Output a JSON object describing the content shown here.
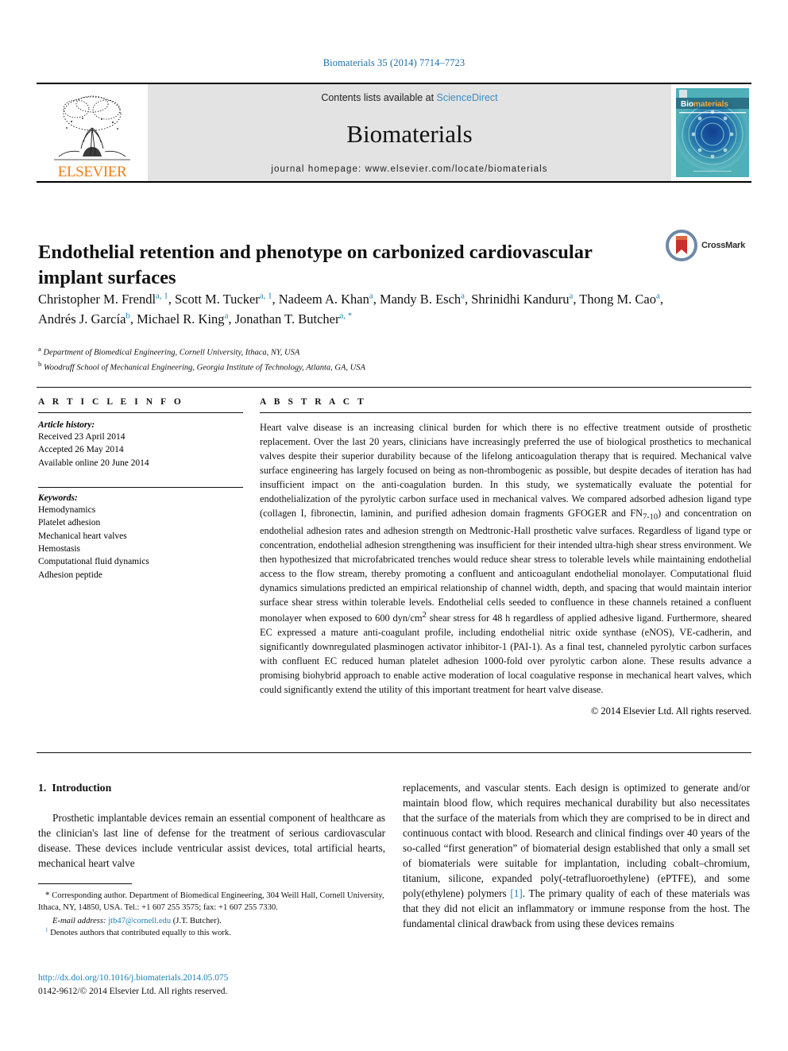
{
  "running_head": "Biomaterials 35 (2014) 7714–7723",
  "masthead": {
    "publisher_name": "ELSEVIER",
    "contents_prefix": "Contents lists available at ",
    "contents_link": "ScienceDirect",
    "journal_name": "Biomaterials",
    "homepage": "journal homepage: www.elsevier.com/locate/biomaterials",
    "cover_title": "Biomaterials",
    "link_color": "#3b8bc4"
  },
  "crossmark": {
    "label": "CrossMark"
  },
  "article": {
    "title": "Endothelial retention and phenotype on carbonized cardiovascular implant surfaces",
    "authors": [
      {
        "name": "Christopher M. Frendl",
        "marks": "a, 1",
        "sep": ", "
      },
      {
        "name": "Scott M. Tucker",
        "marks": "a, 1",
        "sep": ", "
      },
      {
        "name": "Nadeem A. Khan",
        "marks": "a",
        "sep": ", "
      },
      {
        "name": "Mandy B. Esch",
        "marks": "a",
        "sep": ", "
      },
      {
        "name": "Shrinidhi Kanduru",
        "marks": "a",
        "sep": ", "
      },
      {
        "name": "Thong M. Cao",
        "marks": "a",
        "sep": ", "
      },
      {
        "name": "Andrés J. García",
        "marks": "b",
        "sep": ", "
      },
      {
        "name": "Michael R. King",
        "marks": "a",
        "sep": ", "
      },
      {
        "name": "Jonathan T. Butcher",
        "marks": "a, *",
        "sep": ""
      }
    ],
    "affiliations": [
      {
        "mark": "a",
        "text": "Department of Biomedical Engineering, Cornell University, Ithaca, NY, USA"
      },
      {
        "mark": "b",
        "text": "Woodruff School of Mechanical Engineering, Georgia Institute of Technology, Atlanta, GA, USA"
      }
    ]
  },
  "article_info": {
    "heading": "A R T I C L E   I N F O",
    "history_label": "Article history:",
    "history": [
      "Received 23 April 2014",
      "Accepted 26 May 2014",
      "Available online 20 June 2014"
    ],
    "keywords_label": "Keywords:",
    "keywords": [
      "Hemodynamics",
      "Platelet adhesion",
      "Mechanical heart valves",
      "Hemostasis",
      "Computational fluid dynamics",
      "Adhesion peptide"
    ]
  },
  "abstract": {
    "heading": "A B S T R A C T",
    "part1": "Heart valve disease is an increasing clinical burden for which there is no effective treatment outside of prosthetic replacement. Over the last 20 years, clinicians have increasingly preferred the use of biological prosthetics to mechanical valves despite their superior durability because of the lifelong anticoagulation therapy that is required. Mechanical valve surface engineering has largely focused on being as non-thrombogenic as possible, but despite decades of iteration has had insufficient impact on the anti-coagulation burden. In this study, we systematically evaluate the potential for endothelialization of the pyrolytic carbon surface used in mechanical valves. We compared adsorbed adhesion ligand type (collagen I, fibronectin, laminin, and purified adhesion domain fragments GFOGER and FN",
    "sub1": "7-10",
    "part2": ") and concentration on endothelial adhesion rates and adhesion strength on Medtronic-Hall prosthetic valve surfaces. Regardless of ligand type or concentration, endothelial adhesion strengthening was insufficient for their intended ultra-high shear stress environment. We then hypothesized that microfabricated trenches would reduce shear stress to tolerable levels while maintaining endothelial access to the flow stream, thereby promoting a confluent and anticoagulant endothelial monolayer. Computational fluid dynamics simulations predicted an empirical relationship of channel width, depth, and spacing that would maintain interior surface shear stress within tolerable levels. Endothelial cells seeded to confluence in these channels retained a confluent monolayer when exposed to 600 dyn/cm",
    "sup1": "2",
    "part3": " shear stress for 48 h regardless of applied adhesive ligand. Furthermore, sheared EC expressed a mature anti-coagulant profile, including endothelial nitric oxide synthase (eNOS), VE-cadherin, and significantly downregulated plasminogen activator inhibitor-1 (PAI-1). As a final test, channeled pyrolytic carbon surfaces with confluent EC reduced human platelet adhesion 1000-fold over pyrolytic carbon alone. These results advance a promising biohybrid approach to enable active moderation of local coagulative response in mechanical heart valves, which could significantly extend the utility of this important treatment for heart valve disease.",
    "copyright": "© 2014 Elsevier Ltd. All rights reserved."
  },
  "introduction": {
    "number": "1.",
    "heading": "Introduction",
    "left_paragraph": "Prosthetic implantable devices remain an essential component of healthcare as the clinician's last line of defense for the treatment of serious cardiovascular disease. These devices include ventricular assist devices, total artificial hearts, mechanical heart valve",
    "right_part1": "replacements, and vascular stents. Each design is optimized to generate and/or maintain blood flow, which requires mechanical durability but also necessitates that the surface of the materials from which they are comprised to be in direct and continuous contact with blood. Research and clinical findings over 40 years of the so-called “first generation” of biomaterial design established that only a small set of biomaterials were suitable for implantation, including cobalt–chromium, titanium, silicone, expanded poly(-tetrafluoroethylene) (ePTFE), and some poly(ethylene) polymers ",
    "right_citation": "[1]",
    "right_part2": ". The primary quality of each of these materials was that they did not elicit an inflammatory or immune response from the host. The fundamental clinical drawback from using these devices remains"
  },
  "footnotes": {
    "corresponding": "Corresponding author. Department of Biomedical Engineering, 304 Weill Hall, Cornell University, Ithaca, NY, 14850, USA. Tel.: +1 607 255 3575; fax: +1 607 255 7330.",
    "email_label": "E-mail address:",
    "email": "jtb47@cornell.edu",
    "email_owner": "(J.T. Butcher).",
    "equal_contrib_mark": "1",
    "equal_contrib": "Denotes authors that contributed equally to this work.",
    "doi": "http://dx.doi.org/10.1016/j.biomaterials.2014.05.075",
    "issn": "0142-9612/© 2014 Elsevier Ltd. All rights reserved."
  }
}
